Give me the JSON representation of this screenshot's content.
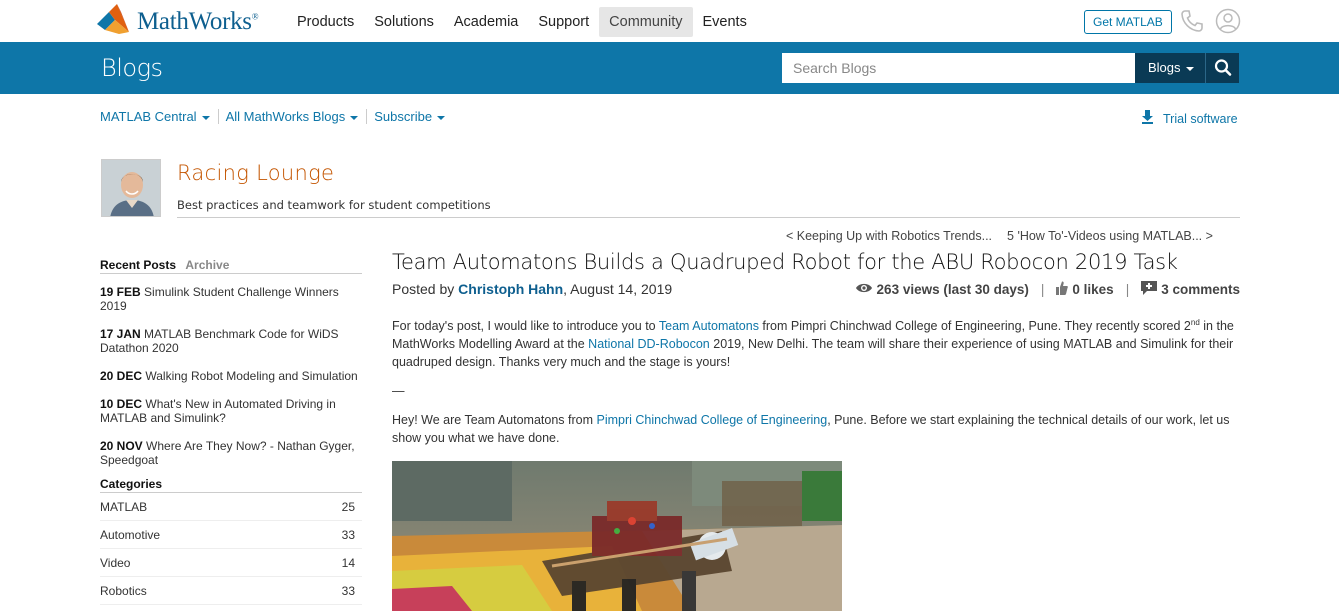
{
  "header": {
    "brand": "MathWorks",
    "brand_mark": "®",
    "nav": [
      "Products",
      "Solutions",
      "Academia",
      "Support",
      "Community",
      "Events"
    ],
    "active_nav": "Community",
    "get_matlab": "Get MATLAB"
  },
  "bluebar": {
    "title": "Blogs",
    "search_placeholder": "Search Blogs",
    "search_scope": "Blogs"
  },
  "subnav": {
    "items": [
      "MATLAB Central",
      "All MathWorks Blogs",
      "Subscribe"
    ],
    "trial": "Trial software"
  },
  "blog": {
    "name": "Racing Lounge",
    "description": "Best practices and teamwork for student competitions",
    "prev": "< Keeping Up with Robotics Trends...",
    "next": "5 'How To'-Videos using MATLAB... >"
  },
  "sidebar": {
    "tab_recent": "Recent Posts",
    "tab_archive": "Archive",
    "posts": [
      {
        "date": "19 FEB",
        "title": "Simulink Student Challenge Winners 2019"
      },
      {
        "date": "17 JAN",
        "title": "MATLAB Benchmark Code for WiDS Datathon 2020"
      },
      {
        "date": "20 DEC",
        "title": "Walking Robot Modeling and Simulation"
      },
      {
        "date": "10 DEC",
        "title": "What's New in Automated Driving in MATLAB and Simulink?"
      },
      {
        "date": "20 NOV",
        "title": "Where Are They Now? - Nathan Gyger, Speedgoat"
      }
    ],
    "categories_title": "Categories",
    "categories": [
      {
        "name": "MATLAB",
        "count": "25"
      },
      {
        "name": "Automotive",
        "count": "33"
      },
      {
        "name": "Video",
        "count": "14"
      },
      {
        "name": "Robotics",
        "count": "33"
      }
    ]
  },
  "post": {
    "title": "Team Automatons Builds a Quadruped Robot for the ABU Robocon 2019 Task",
    "posted_by": "Posted by ",
    "author": "Christoph Hahn",
    "date": ", August 14, 2019",
    "views": "263 views (last 30 days)",
    "likes": "0 likes",
    "comments": "3 comments",
    "p1_a": "For today's post, I would like to introduce you to ",
    "p1_link1": "Team Automatons",
    "p1_b": " from Pimpri Chinchwad College of Engineering, Pune. They recently scored 2",
    "p1_sup": "nd",
    "p1_c": " in the MathWorks Modelling Award at the ",
    "p1_link2": "National DD-Robocon",
    "p1_d": " 2019, New Delhi. The team will share their experience of using MATLAB and Simulink for their quadruped design. Thanks very much and the stage is yours!",
    "dash": "—",
    "p2_a": "Hey! We are Team Automatons from ",
    "p2_link": "Pimpri Chinchwad College of Engineering",
    "p2_b": ", Pune. Before we start explaining the technical details of our work, let us show you what we have done."
  }
}
